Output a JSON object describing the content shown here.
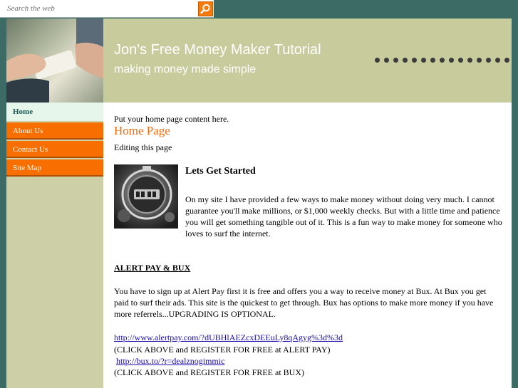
{
  "search": {
    "placeholder": "Search the web",
    "icon": "search-icon"
  },
  "header": {
    "title": "Jon's Free Money Maker Tutorial",
    "tagline": "making money made simple"
  },
  "nav": {
    "items": [
      {
        "label": "Home",
        "active": true
      },
      {
        "label": "About Us"
      },
      {
        "label": "Contact Us"
      },
      {
        "label": "Site Map"
      }
    ]
  },
  "content": {
    "intro": "Put your home page content here.",
    "heading": "Home Page",
    "editing": "Editing this page",
    "feature_title": "Lets Get Started",
    "feature_text": "On my site I have provided a few ways to make money without doing very much.  I cannot guarantee you'll make millions, or $1,000 weekly checks.  But with a little time and patience you will get something tangible out of it.  This is a fun way to make money for someone who loves to surf the internet.",
    "section_title": "ALERT PAY & BUX",
    "section_text": "You have to sign up at Alert Pay first it is free and offers you a way to receive money at Bux.  At Bux you get paid to surf their ads.  This site is the quickest to get through.  Bux has options to make more money if you have more referrels...UPGRADING IS OPTIONAL.",
    "link1": "http://www.alertpay.com/?dUBHlAEZcxDEEuLy8qAgyg%3d%3d",
    "note1": "(CLICK ABOVE and REGISTER FOR FREE at ALERT PAY)",
    "link2": "http://bux.to/?r=dealznogimmic",
    "note2": "(CLICK ABOVE and REGISTER FOR FREE at BUX)"
  },
  "colors": {
    "background": "#3c6a64",
    "header": "#c8cb9c",
    "nav_orange": "#f86f00",
    "heading_orange": "#f26a0c",
    "link": "#1a0dab"
  }
}
